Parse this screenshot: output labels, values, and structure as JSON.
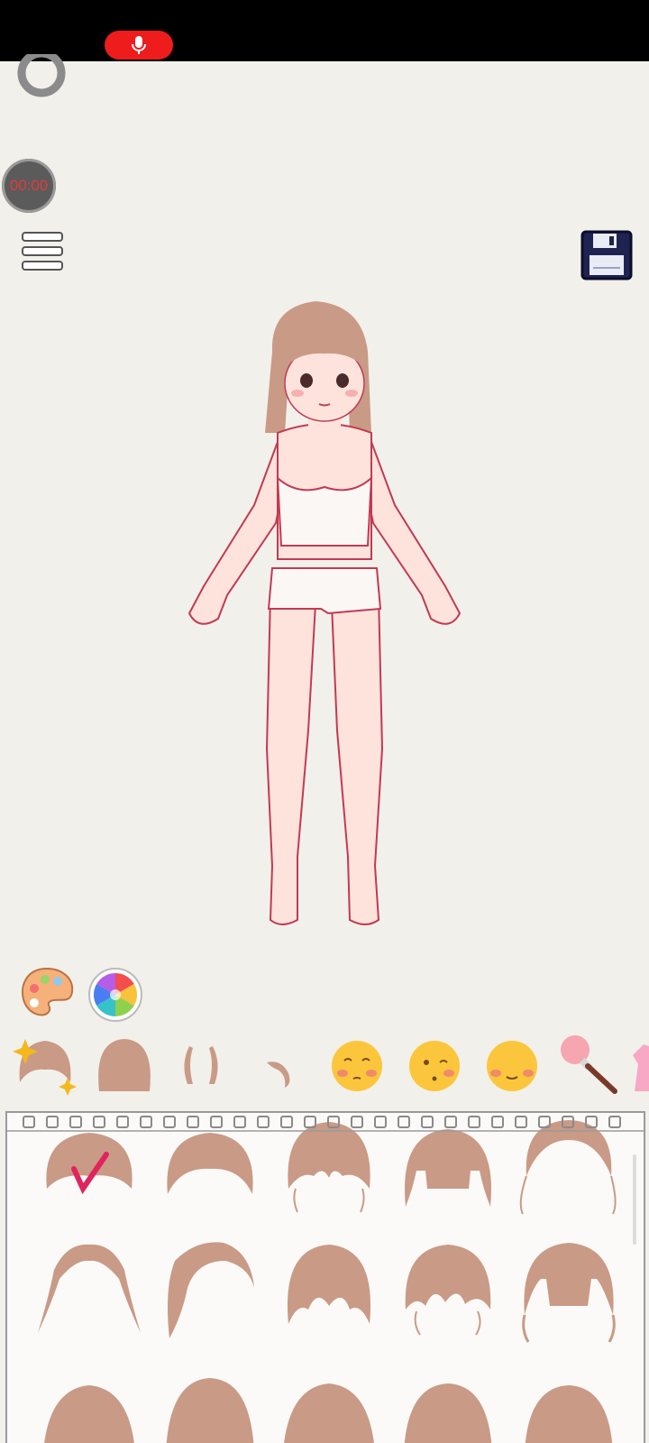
{
  "status_bar": {
    "record_icon": "microphone-icon"
  },
  "overlay": {
    "timer_text": "00:00",
    "ring_icon": "record-ring-icon",
    "timer_color": "#e23b3b",
    "record_color": "#ee1c1c"
  },
  "toolbar": {
    "menu_icon": "hamburger-menu-icon",
    "save_icon": "floppy-disk-icon"
  },
  "color_tools": [
    {
      "name": "palette-button",
      "icon": "paint-palette-icon"
    },
    {
      "name": "color-wheel-button",
      "icon": "color-wheel-icon"
    }
  ],
  "categories": [
    {
      "name": "hair-bangs",
      "selected": true
    },
    {
      "name": "hair-back"
    },
    {
      "name": "ears"
    },
    {
      "name": "ear-single"
    },
    {
      "name": "face-blush"
    },
    {
      "name": "face-wink"
    },
    {
      "name": "face-smile"
    },
    {
      "name": "makeup-brush"
    },
    {
      "name": "clothing"
    }
  ],
  "hair_options_selected_index": 0,
  "colors": {
    "hair": "#c99a86",
    "accent_check": "#e0245e",
    "skin": "#fde3dc",
    "outline": "#c23a52"
  }
}
